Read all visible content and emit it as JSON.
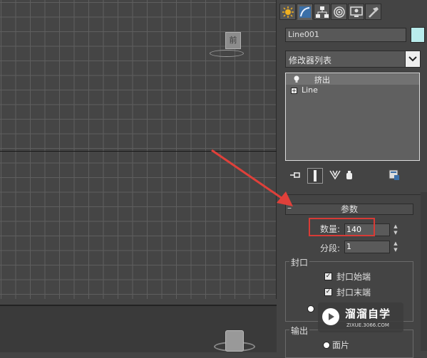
{
  "viewport": {
    "top_view_cube_label": "前",
    "grid": "on"
  },
  "command_panel": {
    "tabs": [
      {
        "icon": "create-icon",
        "active": false
      },
      {
        "icon": "modify-icon",
        "active": true
      },
      {
        "icon": "hierarchy-icon",
        "active": false
      },
      {
        "icon": "motion-icon",
        "active": false
      },
      {
        "icon": "display-icon",
        "active": false
      },
      {
        "icon": "utilities-icon",
        "active": false
      }
    ],
    "object_name": "Line001",
    "object_color": "#b9ecec",
    "modifier_list": "修改器列表",
    "stack": [
      {
        "label": "挤出",
        "selected": true
      },
      {
        "label": "Line",
        "selected": false
      }
    ],
    "stack_toolbar": [
      "pin-stack-icon",
      "show-end-result-icon",
      "make-unique-icon",
      "remove-modifier-icon",
      "configure-modifier-sets-icon"
    ]
  },
  "parameters": {
    "collapse_symbol": "–",
    "title": "参数",
    "amount_label": "数量:",
    "amount_value": "140",
    "segments_label": "分段:",
    "segments_value": "1",
    "capping_group": "封口",
    "cap_start_label": "封口始端",
    "cap_start_checked": true,
    "cap_end_label": "封口末端",
    "cap_end_checked": true,
    "output_group": "输出",
    "output_option": "面片"
  },
  "watermark": {
    "brand": "溜溜自学",
    "url": "ZIXUE.3066.COM"
  },
  "colors": {
    "highlight": "#d83b36",
    "arrow": "#e0403a"
  }
}
